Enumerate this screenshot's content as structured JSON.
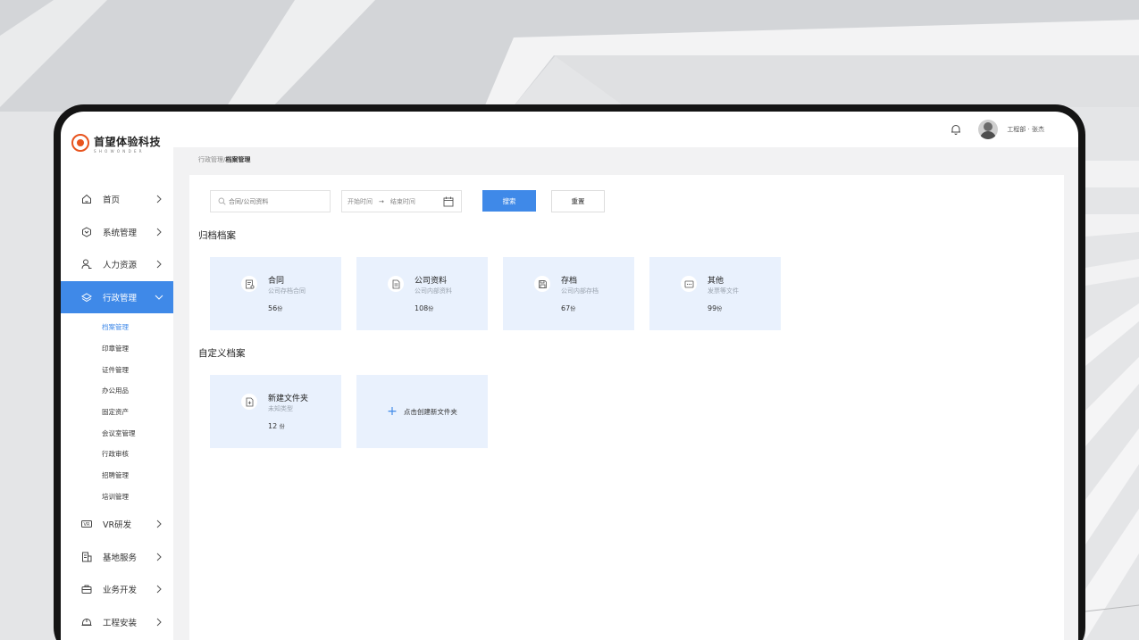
{
  "app": {
    "logo_title": "首望体验科技",
    "logo_subtitle": "SHOWONDER",
    "user_label": "工程部 · 张杰"
  },
  "breadcrumb": {
    "parent": "行政管理/",
    "current": "档案管理"
  },
  "sidebar": {
    "items_top": [
      {
        "label": "首页",
        "icon": "home-icon"
      },
      {
        "label": "系统管理",
        "icon": "settings-icon"
      },
      {
        "label": "人力资源",
        "icon": "user-icon"
      }
    ],
    "active": {
      "label": "行政管理",
      "icon": "layers-icon"
    },
    "subitems": [
      "档案管理",
      "印章管理",
      "证件管理",
      "办公用品",
      "固定资产",
      "会议室管理",
      "行政审核",
      "招聘管理",
      "培训管理"
    ],
    "items_bottom": [
      {
        "label": "VR研发",
        "icon": "vr-icon"
      },
      {
        "label": "基地服务",
        "icon": "building-icon"
      },
      {
        "label": "业务开发",
        "icon": "briefcase-icon"
      },
      {
        "label": "工程安装",
        "icon": "helmet-icon"
      }
    ]
  },
  "filters": {
    "search_placeholder": "合同/公司资料",
    "date_start": "开始时间",
    "date_arrow": "→",
    "date_end": "结束时间",
    "search_button": "搜索",
    "reset_button": "重置"
  },
  "archive_section": {
    "title": "归档档案",
    "cards": [
      {
        "title": "合同",
        "desc": "公司存档合同",
        "count": "56",
        "unit": "份",
        "icon": "contract-icon"
      },
      {
        "title": "公司资料",
        "desc": "公司内部资料",
        "count": "108",
        "unit": "份",
        "icon": "document-icon"
      },
      {
        "title": "存档",
        "desc": "公司内部存档",
        "count": "67",
        "unit": "份",
        "icon": "save-icon"
      },
      {
        "title": "其他",
        "desc": "发票等文件",
        "count": "99",
        "unit": "份",
        "icon": "more-icon"
      }
    ]
  },
  "custom_section": {
    "title": "自定义档案",
    "folder": {
      "title": "新建文件夹",
      "desc": "未知类型",
      "count": "12",
      "unit": "份",
      "icon": "new-file-icon"
    },
    "create_label": "点击创建新文件夹"
  },
  "colors": {
    "accent": "#3f89e8",
    "card_bg": "#e9f1fd",
    "logo": "#e8541e"
  }
}
